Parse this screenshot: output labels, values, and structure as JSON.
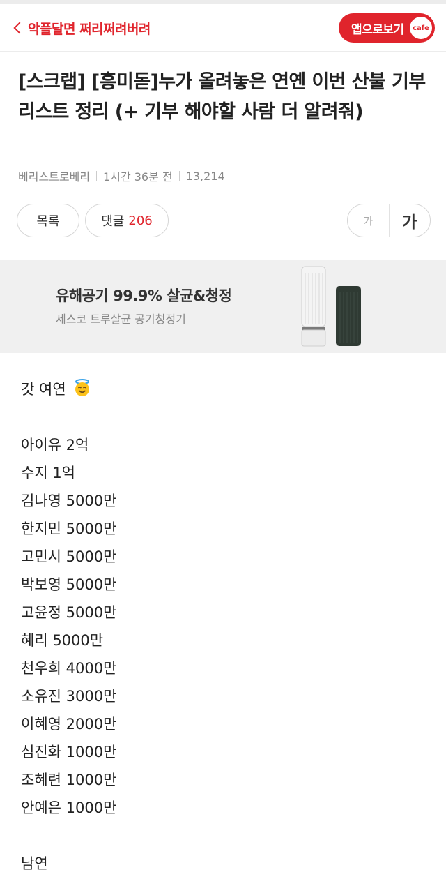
{
  "header": {
    "cafe_name": "악플달면 쩌리쩌려버려",
    "app_button_label": "앱으로보기",
    "app_logo_text": "cafe"
  },
  "post": {
    "title": "[스크랩] [흥미돋]누가 올려놓은 연옌 이번 산불 기부리스트 정리 (+ 기부 해야할 사람 더 알려줘)",
    "author": "베리스트로베리",
    "time": "1시간 36분 전",
    "views": "13,214"
  },
  "actions": {
    "list_label": "목록",
    "comments_label": "댓글",
    "comments_count": "206",
    "font_small": "가",
    "font_large": "가"
  },
  "ad": {
    "headline": "유해공기 99.9% 살균&청정",
    "sub": "세스코 트루살균 공기청정기"
  },
  "content": {
    "female_heading": "갓 여연",
    "female_emoji": "smiling-face-with-halo",
    "female_list": [
      "아이유 2억",
      "수지 1억",
      "김나영 5000만",
      "한지민 5000만",
      "고민시 5000만",
      "박보영 5000만",
      "고윤정 5000만",
      "혜리 5000만",
      "천우희 4000만",
      "소유진 3000만",
      "이혜영 2000만",
      "심진화 1000만",
      "조혜련 1000만",
      "안예은 1000만"
    ],
    "male_heading": "남연"
  },
  "colors": {
    "accent": "#e0242c",
    "ad_background": "#f0f0f0"
  }
}
